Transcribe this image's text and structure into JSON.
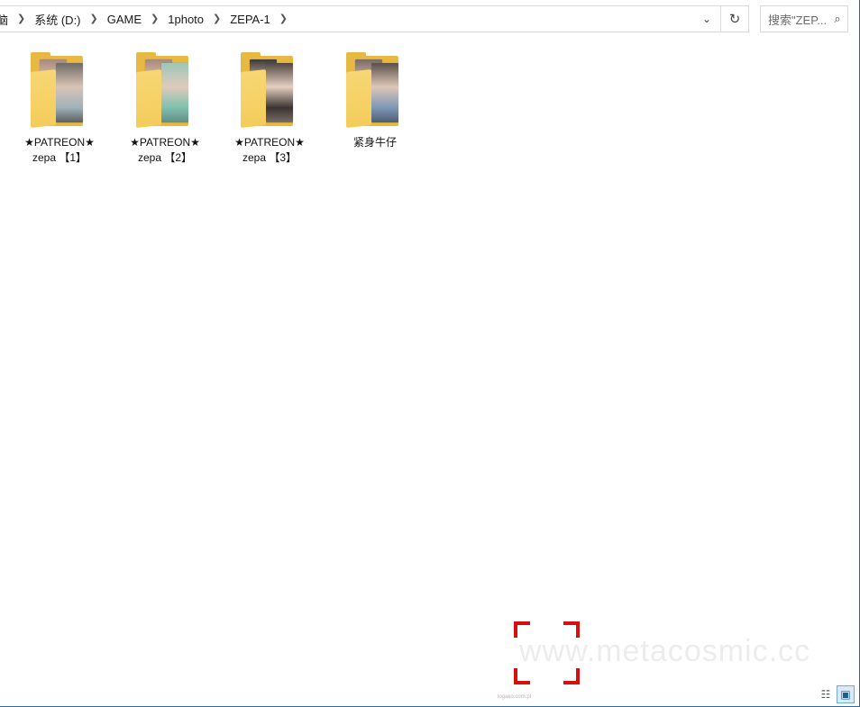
{
  "breadcrumb": {
    "items": [
      "脑",
      "系统 (D:)",
      "GAME",
      "1photo",
      "ZEPA-1"
    ],
    "dropdown_icon": "chevron-down-icon",
    "refresh_icon": "refresh-icon"
  },
  "search": {
    "placeholder": "搜索\"ZEP..."
  },
  "folders": [
    {
      "label": "★PATREON★\nzepa 【1】"
    },
    {
      "label": "★PATREON★\nzepa 【2】"
    },
    {
      "label": "★PATREON★\nzepa 【3】"
    },
    {
      "label": "紧身牛仔"
    }
  ],
  "watermark": {
    "text": "www.metacosmic.cc",
    "small_text": "logako.com.pl"
  },
  "view_toggles": {
    "details_icon": "details-view-icon",
    "large_icon": "large-icons-view-icon"
  },
  "colors": {
    "folder_yellow": "#e8b942",
    "watermark_red": "#d90f0f",
    "accent_blue": "#6fa8d8"
  }
}
